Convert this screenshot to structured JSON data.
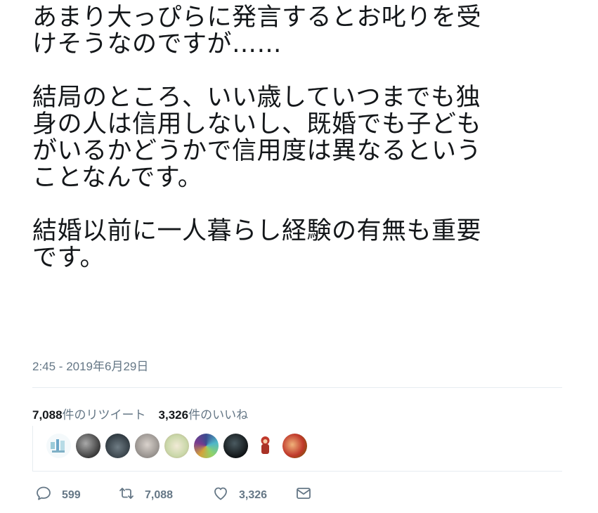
{
  "tweet": {
    "paragraphs": [
      {
        "lines": [
          "あまり大っぴらに発言するとお叱りを受",
          "けそうなのですが……"
        ]
      },
      {
        "lines": [
          "結局のところ、いい歳していつまでも独",
          "身の人は信用しないし、既婚でも子ども",
          "がいるかどうかで信用度は異なるという",
          "ことなんです。"
        ]
      },
      {
        "lines": [
          "結婚以前に一人暮らし経験の有無も重要",
          "です。"
        ]
      }
    ],
    "timestamp": "2:45 - 2019年6月29日"
  },
  "stats": {
    "retweets_count": "7,088",
    "retweets_label": "件のリツイート",
    "likes_count": "3,326",
    "likes_label": "件のいいね"
  },
  "actions": {
    "reply_count": "599",
    "retweet_count": "7,088",
    "like_count": "3,326"
  },
  "colors": {
    "text": "#14171a",
    "muted": "#657786",
    "divider": "#e6ecf0"
  }
}
